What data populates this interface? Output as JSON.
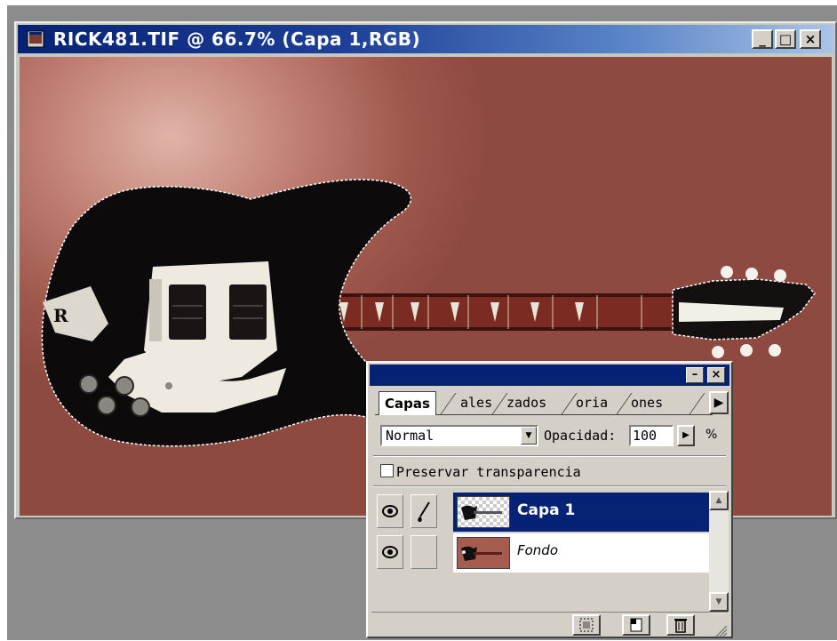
{
  "window": {
    "title": "RICK481.TIF @ 66.7% (Capa 1,RGB)",
    "minimize": "_",
    "maximize": "□",
    "close": "×"
  },
  "layers_panel": {
    "minimize": "–",
    "close": "×",
    "tabs": [
      "Capas",
      "ales",
      "zados",
      "oria",
      "ones"
    ],
    "blend_mode": "Normal",
    "opacity_label": "Opacidad:",
    "opacity_value": "100",
    "percent": "%",
    "preserve_label": "Preservar transparencia",
    "layers": [
      {
        "name": "Capa 1",
        "selected": true
      },
      {
        "name": "Fondo",
        "selected": false
      }
    ]
  },
  "colors": {
    "titlebar": "#062274",
    "selection": "#062274",
    "canvas_bg": "#a65d50",
    "chrome": "#d4d0c8"
  },
  "icons": [
    "document-icon",
    "eye-icon",
    "brush-icon",
    "selection-mask-icon",
    "new-layer-icon",
    "trash-icon"
  ]
}
